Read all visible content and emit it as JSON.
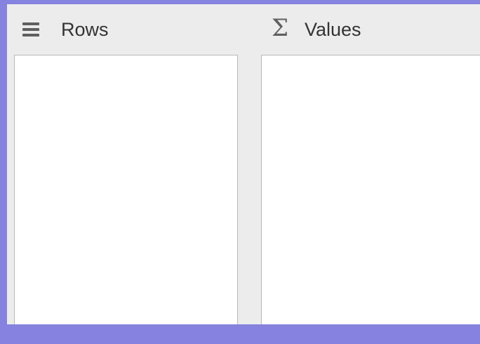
{
  "sections": {
    "rows": {
      "title": "Rows",
      "icon": "rows-icon"
    },
    "values": {
      "title": "Values",
      "icon": "sigma-icon",
      "symbol": "Σ"
    }
  },
  "colors": {
    "outer_background": "#8683e0",
    "panel_background": "#ececec",
    "drop_zone_background": "#ffffff",
    "drop_zone_border": "#b9b9b9",
    "icon": "#5f5f5f",
    "text": "#333333"
  }
}
